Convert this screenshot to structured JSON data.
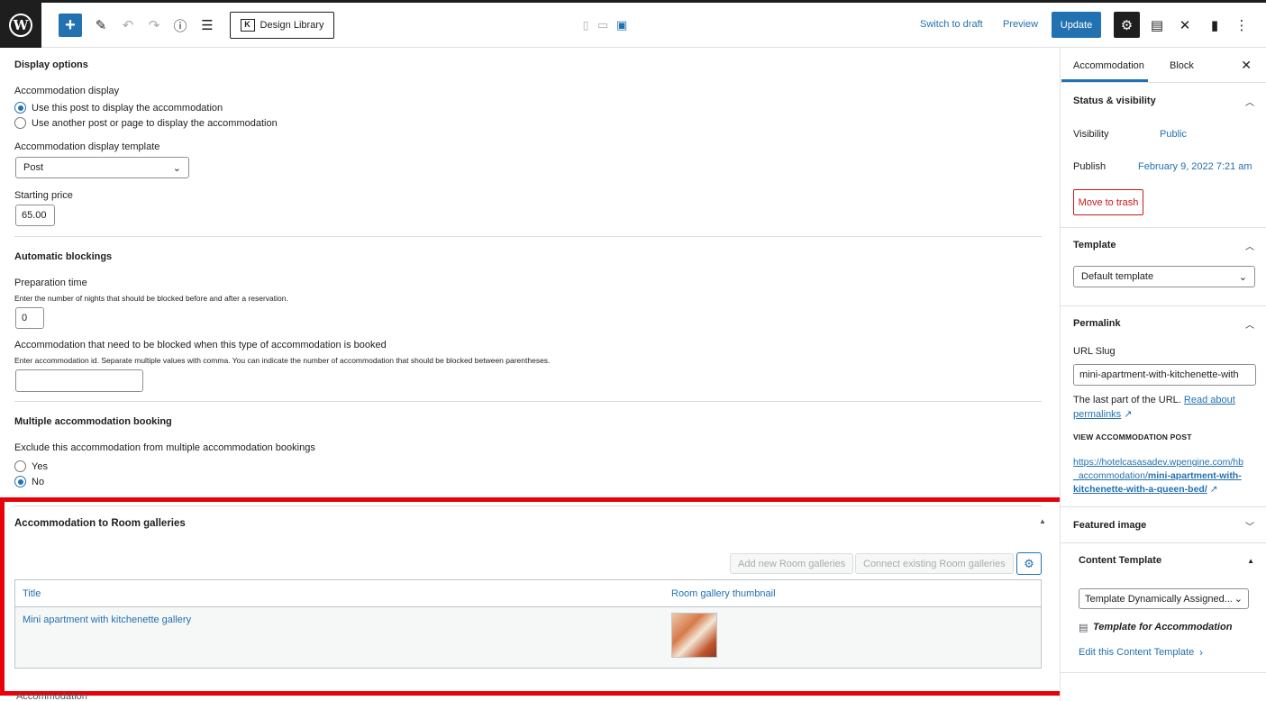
{
  "header": {
    "add_icon": "plus-icon",
    "design_library": "Design Library",
    "switch_to_draft": "Switch to draft",
    "preview": "Preview",
    "update": "Update"
  },
  "main": {
    "display_options": {
      "title": "Display options",
      "accommodation_display_label": "Accommodation display",
      "options": [
        "Use this post to display the accommodation",
        "Use another post or page to display the accommodation"
      ],
      "selected_option": 0,
      "template_label": "Accommodation display template",
      "template_value": "Post",
      "starting_price_label": "Starting price",
      "starting_price_value": "65.00"
    },
    "automatic_blockings": {
      "title": "Automatic blockings",
      "prep_label": "Preparation time",
      "prep_desc": "Enter the number of nights that should be blocked before and after a reservation.",
      "prep_value": "0",
      "blocked_label": "Accommodation that need to be blocked when this type of accommodation is booked",
      "blocked_desc": "Enter accommodation id. Separate multiple values with comma. You can indicate the number of accommodation that should be blocked between parentheses.",
      "blocked_value": ""
    },
    "multiple_booking": {
      "title": "Multiple accommodation booking",
      "exclude_label": "Exclude this accommodation from multiple accommodation bookings",
      "options": [
        "Yes",
        "No"
      ],
      "selected_option": 1
    },
    "room_galleries": {
      "title": "Accommodation to Room galleries",
      "add_new": "Add new Room galleries",
      "connect_existing": "Connect existing Room galleries",
      "columns": [
        "Title",
        "Room gallery thumbnail"
      ],
      "rows": [
        {
          "title": "Mini apartment with kitchenette gallery"
        }
      ]
    },
    "next_section": "Accommodation"
  },
  "sidebar": {
    "tabs": [
      "Accommodation",
      "Block"
    ],
    "status": {
      "title": "Status & visibility",
      "visibility_label": "Visibility",
      "visibility_value": "Public",
      "publish_label": "Publish",
      "publish_value": "February 9, 2022 7:21 am",
      "trash": "Move to trash"
    },
    "template": {
      "title": "Template",
      "value": "Default template"
    },
    "permalink": {
      "title": "Permalink",
      "slug_label": "URL Slug",
      "slug_value": "mini-apartment-with-kitchenette-with",
      "help_text": "The last part of the URL.",
      "read_about": "Read about",
      "permalinks": "permalinks",
      "view_label": "VIEW ACCOMMODATION POST",
      "url_line1": "https://hotelcasasadev.wpengine.com/hb",
      "url_line2a": "_accommodation/",
      "url_line2b": "mini-apartment-with-",
      "url_line3": "kitchenette-with-a-queen-bed/"
    },
    "featured_image": {
      "title": "Featured image"
    },
    "content_template": {
      "title": "Content Template",
      "select_value": "Template Dynamically Assigned...",
      "template_name": "Template for Accommodation",
      "edit_link": "Edit this Content Template"
    }
  },
  "colors": {
    "accent": "#2271b1",
    "highlight": "#e8000b",
    "danger": "#cc1818"
  }
}
